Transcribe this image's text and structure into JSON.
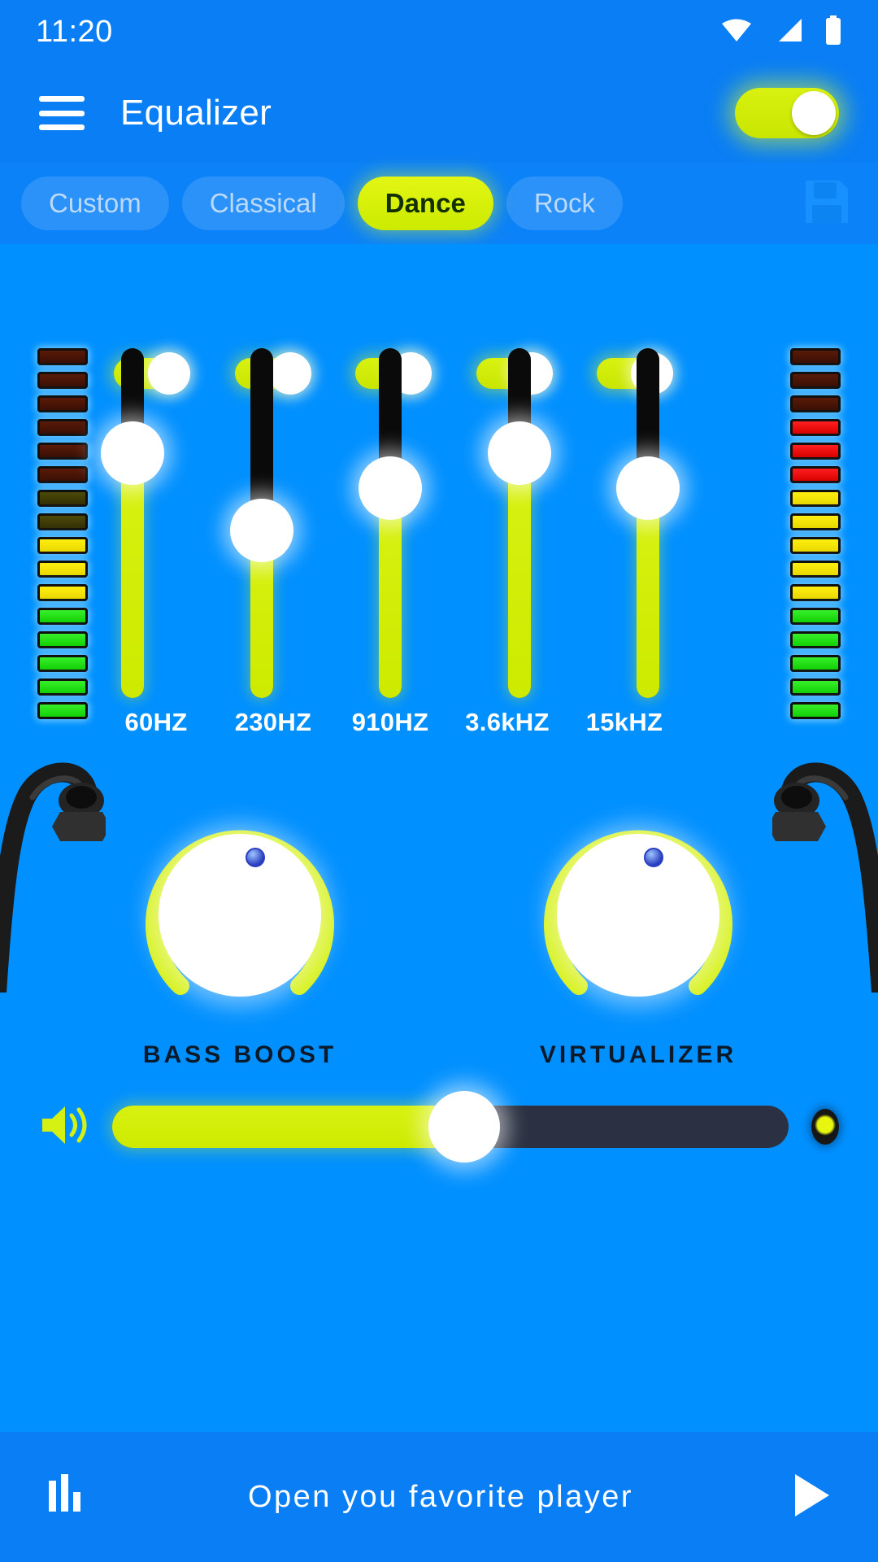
{
  "status_bar": {
    "time": "11:20",
    "icons": [
      "wifi-icon",
      "cellular-signal-icon",
      "battery-icon"
    ]
  },
  "app_bar": {
    "menu_icon": "hamburger-menu-icon",
    "title": "Equalizer",
    "master_switch": {
      "state": "on",
      "color": "#d5f113"
    }
  },
  "presets": {
    "items": [
      {
        "label": "Custom",
        "active": false
      },
      {
        "label": "Classical",
        "active": false
      },
      {
        "label": "Dance",
        "active": true
      },
      {
        "label": "Rock",
        "active": false
      }
    ],
    "save_icon": "save-floppy-disk-icon"
  },
  "equalizer": {
    "bands": [
      {
        "label": "60HZ",
        "enabled": true,
        "level": 70
      },
      {
        "label": "230HZ",
        "enabled": true,
        "level": 48
      },
      {
        "label": "910HZ",
        "enabled": true,
        "level": 60
      },
      {
        "label": "3.6kHZ",
        "enabled": true,
        "level": 70
      },
      {
        "label": "15kHZ",
        "enabled": true,
        "level": 60
      }
    ],
    "vu_left": [
      "dim-red",
      "dim-red",
      "dim-red",
      "dim-red",
      "dim-red",
      "dim-red",
      "dim-yellow",
      "dim-yellow",
      "yellow",
      "yellow",
      "yellow",
      "green",
      "green",
      "green",
      "green",
      "green"
    ],
    "vu_right": [
      "dim-red",
      "dim-red",
      "dim-red",
      "red",
      "red",
      "red",
      "yellow",
      "yellow",
      "yellow",
      "yellow",
      "yellow",
      "green",
      "green",
      "green",
      "green",
      "green"
    ]
  },
  "knobs": [
    {
      "label": "BASS BOOST",
      "value": 52
    },
    {
      "label": "VIRTUALIZER",
      "value": 52
    }
  ],
  "volume": {
    "speaker_icon": "speaker-volume-icon",
    "level": 52
  },
  "bottom_bar": {
    "equalizer_icon": "equalizer-bars-icon",
    "label": "Open you favorite player",
    "play_icon": "play-triangle-icon"
  },
  "colors": {
    "background": "#0090ff",
    "header": "#0a7ef5",
    "accent": "#d5f113",
    "accent_text": "#123000"
  }
}
